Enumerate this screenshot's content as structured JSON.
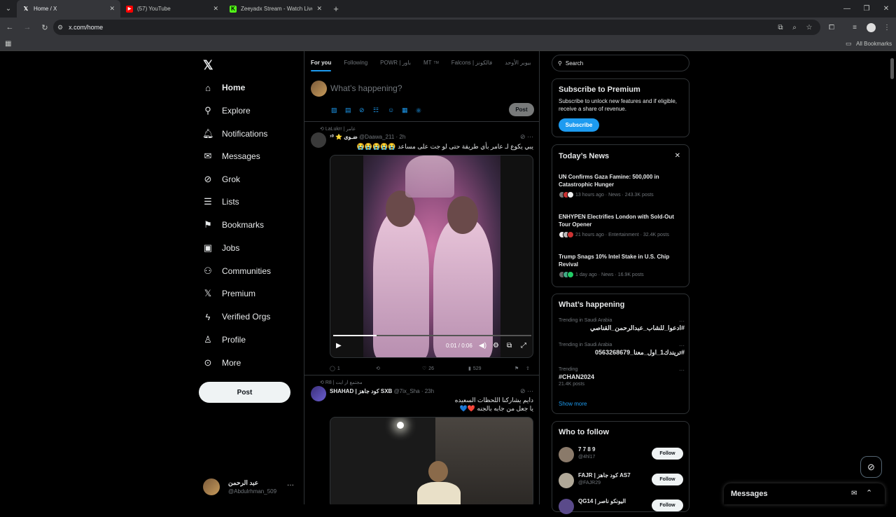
{
  "browser": {
    "tabs": [
      {
        "title": "Home / X",
        "icon": "x-logo-icon",
        "active": true
      },
      {
        "title": "(57) YouTube",
        "icon": "youtube-icon",
        "active": false
      },
      {
        "title": "Zeeyadx Stream - Watch Live o",
        "icon": "kick-icon",
        "active": false
      }
    ],
    "url": "x.com/home",
    "bookmarks_label": "All Bookmarks"
  },
  "colors": {
    "accent": "#1d9bf0",
    "bg": "#000000",
    "border": "#2f3336",
    "muted": "#71767b"
  },
  "leftnav": {
    "items": [
      {
        "label": "Home",
        "icon": "home-icon"
      },
      {
        "label": "Explore",
        "icon": "search-icon"
      },
      {
        "label": "Notifications",
        "icon": "bell-icon"
      },
      {
        "label": "Messages",
        "icon": "envelope-icon"
      },
      {
        "label": "Grok",
        "icon": "grok-icon"
      },
      {
        "label": "Lists",
        "icon": "list-icon"
      },
      {
        "label": "Bookmarks",
        "icon": "bookmark-icon"
      },
      {
        "label": "Jobs",
        "icon": "briefcase-icon"
      },
      {
        "label": "Communities",
        "icon": "people-icon"
      },
      {
        "label": "Premium",
        "icon": "x-logo-icon"
      },
      {
        "label": "Verified Orgs",
        "icon": "lightning-icon"
      },
      {
        "label": "Profile",
        "icon": "person-icon"
      },
      {
        "label": "More",
        "icon": "more-circle-icon"
      }
    ],
    "post_label": "Post",
    "account": {
      "name": "عبد الرحمن",
      "handle": "@Abdulrhman_509"
    }
  },
  "feed": {
    "tabs": [
      "For you",
      "Following",
      "POWR | باور",
      "MT",
      "Falcons | فالكونز",
      "بيوبر الأوحد"
    ],
    "tab_badge": "TM",
    "compose_placeholder": "What’s happening?",
    "compose_post": "Post",
    "tweets": [
      {
        "reposted_by": "LaLukrr | عامر",
        "author": "ضـوى ⭐️ ¹⁰",
        "handle": "@Daawa_211",
        "time": "2h",
        "text": "يبي يكوع لـ عامر بأي طريقة حتى لو جت على مساعد 😭😭😭😭😭",
        "video_time": "0:01 / 0:06",
        "video_progress": 0.22,
        "replies": "1",
        "likes": "26",
        "views": "529"
      },
      {
        "reposted_by": "R8 | مجتمع ار ايت",
        "author": "SHAHAD | كود جاهز SXB",
        "handle": "@7ix_Sha",
        "time": "23h",
        "text_line1": "دايم يشاركنا اللحظات السعيده",
        "text_line2": "يا جعل من جابه بالجنه ❤️💙"
      }
    ]
  },
  "right": {
    "search_placeholder": "Search",
    "premium": {
      "title": "Subscribe to Premium",
      "body": "Subscribe to unlock new features and if eligible, receive a share of revenue.",
      "button": "Subscribe"
    },
    "news": {
      "title": "Today’s News",
      "items": [
        {
          "title": "UN Confirms Gaza Famine: 500,000 in Catastrophic Hunger",
          "meta": "13 hours ago · News · 243.3K posts"
        },
        {
          "title": "ENHYPEN Electrifies London with Sold-Out Tour Opener",
          "meta": "21 hours ago · Entertainment · 32.4K posts"
        },
        {
          "title": "Trump Snags 10% Intel Stake in U.S. Chip Revival",
          "meta": "1 day ago · News · 16.9K posts"
        }
      ]
    },
    "happening": {
      "title": "What’s happening",
      "trends": [
        {
          "context": "Trending in Saudi Arabia",
          "name": "#ادعوا_للشاب_عبدالرحمن_القناصي",
          "posts": ""
        },
        {
          "context": "Trending in Saudi Arabia",
          "name": "#تريندك1_اول_معنا_0563268679",
          "posts": ""
        },
        {
          "context": "Trending",
          "name": "#CHAN2024",
          "posts": "21.4K posts"
        }
      ],
      "show_more": "Show more"
    },
    "who_to_follow": {
      "title": "Who to follow",
      "accounts": [
        {
          "name": "7 7 8 9",
          "handle": "@4hl17"
        },
        {
          "name": "FAJR | كود جاهز AS7",
          "handle": "@FAJR29"
        },
        {
          "name": "QG14 | اليونكو ناصر",
          "handle": ""
        }
      ],
      "follow_label": "Follow"
    }
  },
  "messages_drawer": {
    "title": "Messages"
  }
}
